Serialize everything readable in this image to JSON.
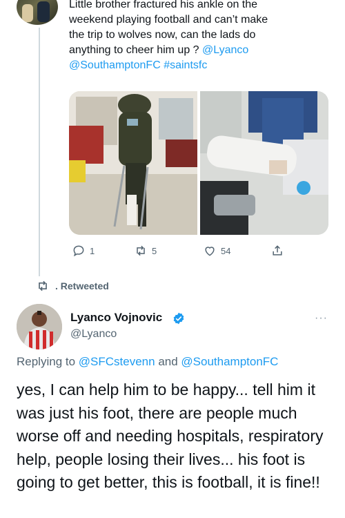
{
  "colors": {
    "link": "#1d9bf0",
    "text": "#0f1419",
    "muted": "#536471",
    "thread": "#cfd9de",
    "verified": "#1d9bf0"
  },
  "tweet1": {
    "text_line1": "Little brother fractured his ankle on the",
    "text_line2": "weekend playing football and can’t make",
    "text_line3": "the trip to wolves now, can the lads do",
    "text_line4_plain": "anything to cheer him up ? ",
    "mention1": "@Lyanco",
    "mention2": "@SouthamptonFC",
    "hashtag": "#saintsfc",
    "reply_count": "1",
    "retweet_count": "5",
    "like_count": "54",
    "icons": [
      "reply-icon",
      "retweet-icon",
      "like-icon",
      "share-icon"
    ]
  },
  "retweet_banner": {
    "label": ". Retweeted",
    "icon": "retweet-icon"
  },
  "tweet2": {
    "display_name": "Lyanco Vojnovic",
    "handle": "@Lyanco",
    "verified_icon": "verified-badge-icon",
    "more_icon": "more-dots-icon",
    "more_label": "···",
    "replying_prefix": "Replying to ",
    "reply_user1": "@SFCstevenn",
    "reply_and": " and ",
    "reply_user2": "@SouthamptonFC",
    "text": "yes, I can help him to be happy... tell him it was just his foot, there are people much worse off and needing hospitals, respiratory help, people losing their lives... his foot is going to get better, this is football,  it is fine!!"
  }
}
